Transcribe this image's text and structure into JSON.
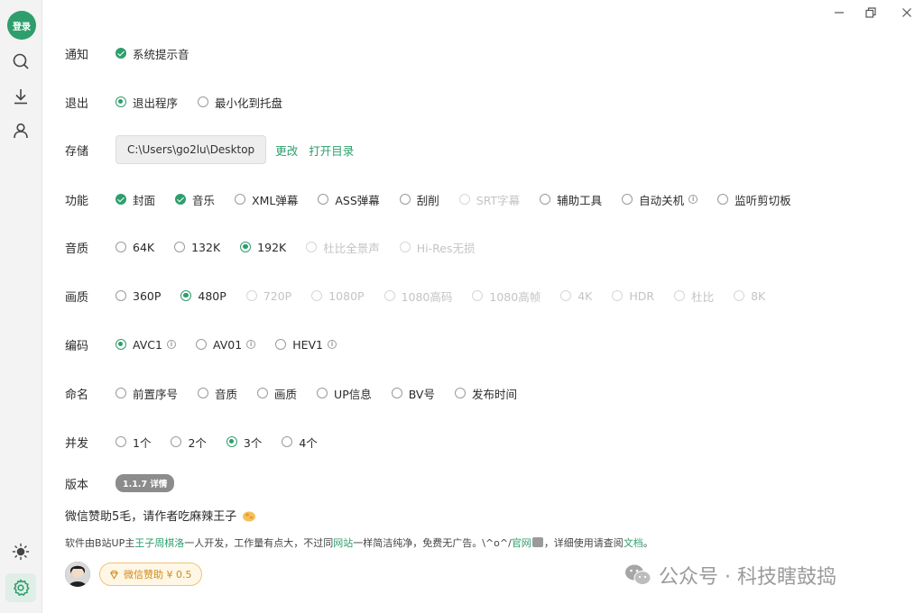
{
  "sidebar": {
    "login_label": "登录",
    "items": [
      {
        "icon": "search-icon"
      },
      {
        "icon": "download-icon"
      },
      {
        "icon": "user-icon"
      },
      {
        "icon": "theme-sun-icon"
      },
      {
        "icon": "gear-icon"
      }
    ],
    "accent": "#2e9e6c"
  },
  "titlebar": {
    "icons": [
      "minimize-icon",
      "restore-icon",
      "close-icon"
    ]
  },
  "settings": {
    "notify": {
      "label": "通知",
      "options": [
        {
          "text": "系统提示音",
          "state": "checked"
        }
      ]
    },
    "exit": {
      "label": "退出",
      "options": [
        {
          "text": "退出程序",
          "state": "selected"
        },
        {
          "text": "最小化到托盘",
          "state": "off"
        }
      ]
    },
    "storage": {
      "label": "存储",
      "path": "C:\\Users\\go2lu\\Desktop",
      "change": "更改",
      "open_dir": "打开目录"
    },
    "features": {
      "label": "功能",
      "options": [
        {
          "text": "封面",
          "state": "checked"
        },
        {
          "text": "音乐",
          "state": "checked"
        },
        {
          "text": "XML弹幕",
          "state": "off"
        },
        {
          "text": "ASS弹幕",
          "state": "off"
        },
        {
          "text": "刮削",
          "state": "off"
        },
        {
          "text": "SRT字幕",
          "state": "disabled"
        },
        {
          "text": "辅助工具",
          "state": "off"
        },
        {
          "text": "自动关机",
          "state": "off",
          "info": true
        },
        {
          "text": "监听剪切板",
          "state": "off"
        }
      ]
    },
    "audio": {
      "label": "音质",
      "options": [
        {
          "text": "64K",
          "state": "off"
        },
        {
          "text": "132K",
          "state": "off"
        },
        {
          "text": "192K",
          "state": "selected"
        },
        {
          "text": "杜比全景声",
          "state": "disabled"
        },
        {
          "text": "Hi-Res无损",
          "state": "disabled"
        }
      ]
    },
    "video": {
      "label": "画质",
      "options": [
        {
          "text": "360P",
          "state": "off"
        },
        {
          "text": "480P",
          "state": "selected"
        },
        {
          "text": "720P",
          "state": "disabled"
        },
        {
          "text": "1080P",
          "state": "disabled"
        },
        {
          "text": "1080高码",
          "state": "disabled"
        },
        {
          "text": "1080高帧",
          "state": "disabled"
        },
        {
          "text": "4K",
          "state": "disabled"
        },
        {
          "text": "HDR",
          "state": "disabled"
        },
        {
          "text": "杜比",
          "state": "disabled"
        },
        {
          "text": "8K",
          "state": "disabled"
        }
      ]
    },
    "codec": {
      "label": "编码",
      "options": [
        {
          "text": "AVC1",
          "state": "selected",
          "info": true
        },
        {
          "text": "AV01",
          "state": "off",
          "info": true
        },
        {
          "text": "HEV1",
          "state": "off",
          "info": true
        }
      ]
    },
    "naming": {
      "label": "命名",
      "options": [
        {
          "text": "前置序号",
          "state": "off"
        },
        {
          "text": "音质",
          "state": "off"
        },
        {
          "text": "画质",
          "state": "off"
        },
        {
          "text": "UP信息",
          "state": "off"
        },
        {
          "text": "BV号",
          "state": "off"
        },
        {
          "text": "发布时间",
          "state": "off"
        }
      ]
    },
    "concurrency": {
      "label": "并发",
      "options": [
        {
          "text": "1个",
          "state": "off"
        },
        {
          "text": "2个",
          "state": "off"
        },
        {
          "text": "3个",
          "state": "selected"
        },
        {
          "text": "4个",
          "state": "off"
        }
      ]
    },
    "version": {
      "label": "版本",
      "pill": "1.1.7 详情"
    }
  },
  "footer": {
    "donate_title": "微信赞助5毛，请作者吃麻辣王子",
    "credits": {
      "p1": "软件由B站UP主",
      "author": "王子周棋洛",
      "p2": "一人开发，工作量有点大，不过同",
      "site": "网站",
      "p3": "一样简洁纯净，免费无广告。\\^o^/",
      "official": "官网",
      "p4": "，详细使用请查阅",
      "docs": "文档",
      "p5": "。"
    },
    "donate_button": "微信赞助 ¥ 0.5"
  },
  "watermark": {
    "text": "公众号 · 科技瞎鼓捣"
  }
}
